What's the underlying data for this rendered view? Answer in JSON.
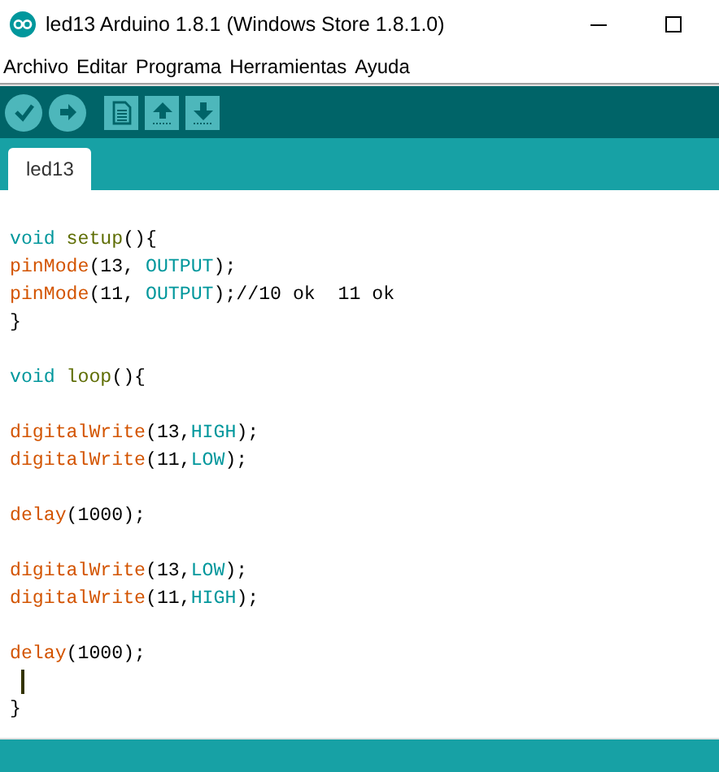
{
  "window": {
    "title": "led13 Arduino 1.8.1 (Windows Store 1.8.1.0)"
  },
  "menu": [
    "Archivo",
    "Editar",
    "Programa",
    "Herramientas",
    "Ayuda"
  ],
  "toolbar": [
    {
      "kind": "verify"
    },
    {
      "kind": "upload"
    },
    {
      "kind": "new"
    },
    {
      "kind": "open"
    },
    {
      "kind": "save"
    }
  ],
  "tabs": [
    {
      "label": "led13",
      "selected": true
    }
  ],
  "editor": {
    "lines": [
      {
        "cursor": false
      },
      {
        "cursor": false,
        "tokens": [
          {
            "text": "void ",
            "kind": "type"
          },
          {
            "text": "setup",
            "kind": "structure"
          },
          {
            "text": "(){",
            "kind": "plain"
          }
        ]
      },
      {
        "cursor": false,
        "tokens": [
          {
            "text": "pinMode",
            "kind": "function"
          },
          {
            "text": "(13, ",
            "kind": "plain"
          },
          {
            "text": "OUTPUT",
            "kind": "constant"
          },
          {
            "text": ");",
            "kind": "plain"
          }
        ]
      },
      {
        "cursor": false,
        "tokens": [
          {
            "text": "pinMode",
            "kind": "function"
          },
          {
            "text": "(11, ",
            "kind": "plain"
          },
          {
            "text": "OUTPUT",
            "kind": "constant"
          },
          {
            "text": ");//10 ok  11 ok",
            "kind": "plain"
          }
        ]
      },
      {
        "cursor": false,
        "tokens": [
          {
            "text": "}",
            "kind": "plain"
          }
        ]
      },
      {
        "cursor": false
      },
      {
        "cursor": false,
        "tokens": [
          {
            "text": "void ",
            "kind": "type"
          },
          {
            "text": "loop",
            "kind": "structure"
          },
          {
            "text": "(){",
            "kind": "plain"
          }
        ]
      },
      {
        "cursor": false
      },
      {
        "cursor": false,
        "tokens": [
          {
            "text": "digitalWrite",
            "kind": "function"
          },
          {
            "text": "(13,",
            "kind": "plain"
          },
          {
            "text": "HIGH",
            "kind": "constant"
          },
          {
            "text": ");",
            "kind": "plain"
          }
        ]
      },
      {
        "cursor": false,
        "tokens": [
          {
            "text": "digitalWrite",
            "kind": "function"
          },
          {
            "text": "(11,",
            "kind": "plain"
          },
          {
            "text": "LOW",
            "kind": "constant"
          },
          {
            "text": ");",
            "kind": "plain"
          }
        ]
      },
      {
        "cursor": false
      },
      {
        "cursor": false,
        "tokens": [
          {
            "text": "delay",
            "kind": "function"
          },
          {
            "text": "(1000);",
            "kind": "plain"
          }
        ]
      },
      {
        "cursor": false
      },
      {
        "cursor": false,
        "tokens": [
          {
            "text": "digitalWrite",
            "kind": "function"
          },
          {
            "text": "(13,",
            "kind": "plain"
          },
          {
            "text": "LOW",
            "kind": "constant"
          },
          {
            "text": ");",
            "kind": "plain"
          }
        ]
      },
      {
        "cursor": false,
        "tokens": [
          {
            "text": "digitalWrite",
            "kind": "function"
          },
          {
            "text": "(11,",
            "kind": "plain"
          },
          {
            "text": "HIGH",
            "kind": "constant"
          },
          {
            "text": ");",
            "kind": "plain"
          }
        ]
      },
      {
        "cursor": false
      },
      {
        "cursor": false,
        "tokens": [
          {
            "text": "delay",
            "kind": "function"
          },
          {
            "text": "(1000);",
            "kind": "plain"
          }
        ]
      },
      {
        "cursor": true
      },
      {
        "cursor": false,
        "tokens": [
          {
            "text": "}",
            "kind": "plain"
          }
        ]
      }
    ]
  }
}
